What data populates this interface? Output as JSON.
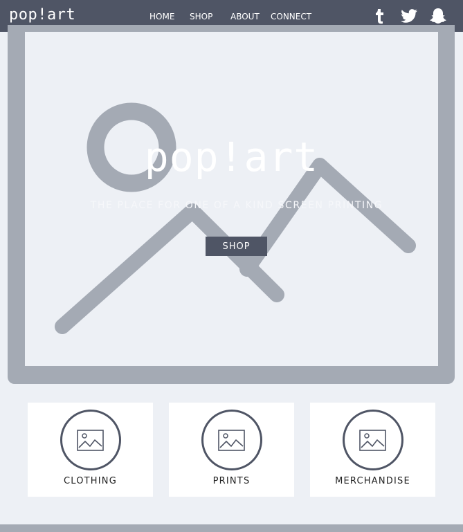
{
  "brand": {
    "logo": "pop!art"
  },
  "nav": {
    "items": [
      "HOME",
      "SHOP",
      "ABOUT",
      "CONNECT"
    ]
  },
  "social": {
    "icons": [
      "tumblr-icon",
      "twitter-icon",
      "snapchat-icon"
    ]
  },
  "hero": {
    "title": "pop!art",
    "subtitle": "THE PLACE FOR ONE OF A KIND SCREEN PRINTING",
    "button_label": "SHOP"
  },
  "categories": [
    {
      "label": "CLOTHING"
    },
    {
      "label": "PRINTS"
    },
    {
      "label": "MERCHANDISE"
    }
  ],
  "colors": {
    "topbar": "#4f5565",
    "page_background": "#edf0f5",
    "placeholder_gray": "#a4aab4",
    "card_background": "#ffffff"
  }
}
